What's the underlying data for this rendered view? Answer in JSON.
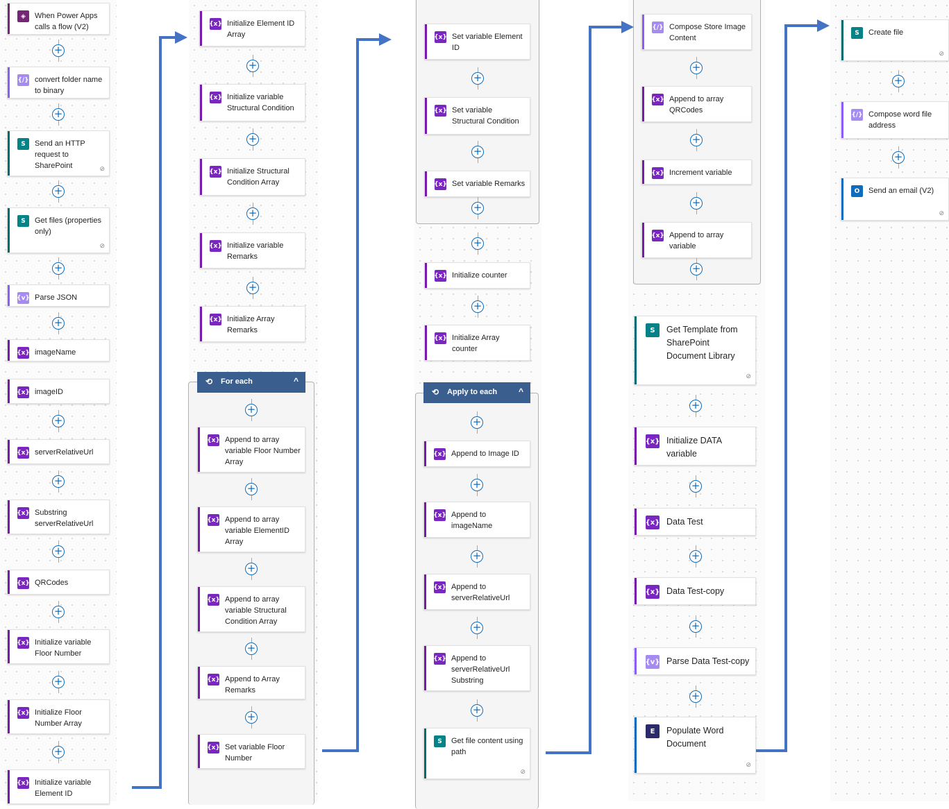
{
  "colors": {
    "variable_accent": "#7719aa",
    "variable_icon": "#7a26c1",
    "compose_accent": "#8b5cf6",
    "compose_icon": "#a58bf2",
    "sharepoint_accent": "#036c70",
    "sharepoint_icon": "#038387",
    "powerapps_accent": "#742774",
    "outlook_accent": "#0f6cbd",
    "loop_header": "#3a5f8f",
    "connector_arrow": "#4472c4"
  },
  "icons": {
    "variable": "{x}",
    "compose": "{/}",
    "parse": "{v}",
    "sharepoint": "S",
    "powerapps": "◈",
    "outlook": "O",
    "word": "E",
    "loop": "⟲",
    "collapse": "^",
    "link": "⊘",
    "add": "+"
  },
  "columns": {
    "col1": [
      {
        "label": "When Power Apps calls a flow (V2)",
        "type": "powerapps"
      },
      {
        "label": "convert folder name to binary",
        "type": "compose"
      },
      {
        "label": "Send an HTTP request to SharePoint",
        "type": "sharepoint"
      },
      {
        "label": "Get files (properties only)",
        "type": "sharepoint"
      },
      {
        "label": "Parse JSON",
        "type": "parse"
      },
      {
        "label": "imageName",
        "type": "variable"
      },
      {
        "label": "imageID",
        "type": "variable"
      },
      {
        "label": "serverRelativeUrl",
        "type": "variable"
      },
      {
        "label": "Substring serverRelativeUrl",
        "type": "variable"
      },
      {
        "label": "QRCodes",
        "type": "variable"
      },
      {
        "label": "Initialize variable Floor Number",
        "type": "variable"
      },
      {
        "label": "Initialize Floor Number Array",
        "type": "variable"
      },
      {
        "label": "Initialize variable Element ID",
        "type": "variable"
      }
    ],
    "col2": [
      {
        "label": "Initialize Element ID Array",
        "type": "variable"
      },
      {
        "label": "Initialize variable Structural Condition",
        "type": "variable"
      },
      {
        "label": "Initialize Structural Condition Array",
        "type": "variable"
      },
      {
        "label": "Initialize variable Remarks",
        "type": "variable"
      },
      {
        "label": "Initialize Array Remarks",
        "type": "variable"
      }
    ],
    "col2_loop": {
      "title": "For each",
      "items": [
        {
          "label": "Append to array variable Floor Number Array",
          "type": "variable"
        },
        {
          "label": "Append to array variable ElementID Array",
          "type": "variable"
        },
        {
          "label": "Append to array variable Structural Condition Array",
          "type": "variable"
        },
        {
          "label": "Append to Array Remarks",
          "type": "variable"
        },
        {
          "label": "Set variable Floor Number",
          "type": "variable"
        }
      ]
    },
    "col3_top": [
      {
        "label": "Set variable Element ID",
        "type": "variable"
      },
      {
        "label": "Set variable Structural Condition",
        "type": "variable"
      },
      {
        "label": "Set variable Remarks",
        "type": "variable"
      }
    ],
    "col3": [
      {
        "label": "Initialize counter",
        "type": "variable"
      },
      {
        "label": "Initialize Array counter",
        "type": "variable"
      }
    ],
    "col3_loop": {
      "title": "Apply to each",
      "items": [
        {
          "label": "Append to Image ID",
          "type": "variable"
        },
        {
          "label": "Append to imageName",
          "type": "variable"
        },
        {
          "label": "Append to serverRelativeUrl",
          "type": "variable"
        },
        {
          "label": "Append to serverRelativeUrl Substring",
          "type": "variable"
        },
        {
          "label": "Get file content using path",
          "type": "sharepoint"
        }
      ]
    },
    "col4_top": [
      {
        "label": "Compose Store Image Content",
        "type": "compose"
      },
      {
        "label": "Append to array QRCodes",
        "type": "variable"
      },
      {
        "label": "Increment variable",
        "type": "variable"
      },
      {
        "label": "Append to array variable",
        "type": "variable"
      }
    ],
    "col4": [
      {
        "label": "Get Template from SharePoint Document Library",
        "type": "sharepoint"
      },
      {
        "label": "Initialize DATA variable",
        "type": "variable"
      },
      {
        "label": "Data Test",
        "type": "variable"
      },
      {
        "label": "Data Test-copy",
        "type": "variable"
      },
      {
        "label": "Parse Data Test-copy",
        "type": "parse"
      },
      {
        "label": "Populate Word Document",
        "type": "word"
      }
    ],
    "col5": [
      {
        "label": "Create file",
        "type": "sharepoint"
      },
      {
        "label": "Compose word file address",
        "type": "compose"
      },
      {
        "label": "Send an email (V2)",
        "type": "outlook"
      }
    ]
  }
}
